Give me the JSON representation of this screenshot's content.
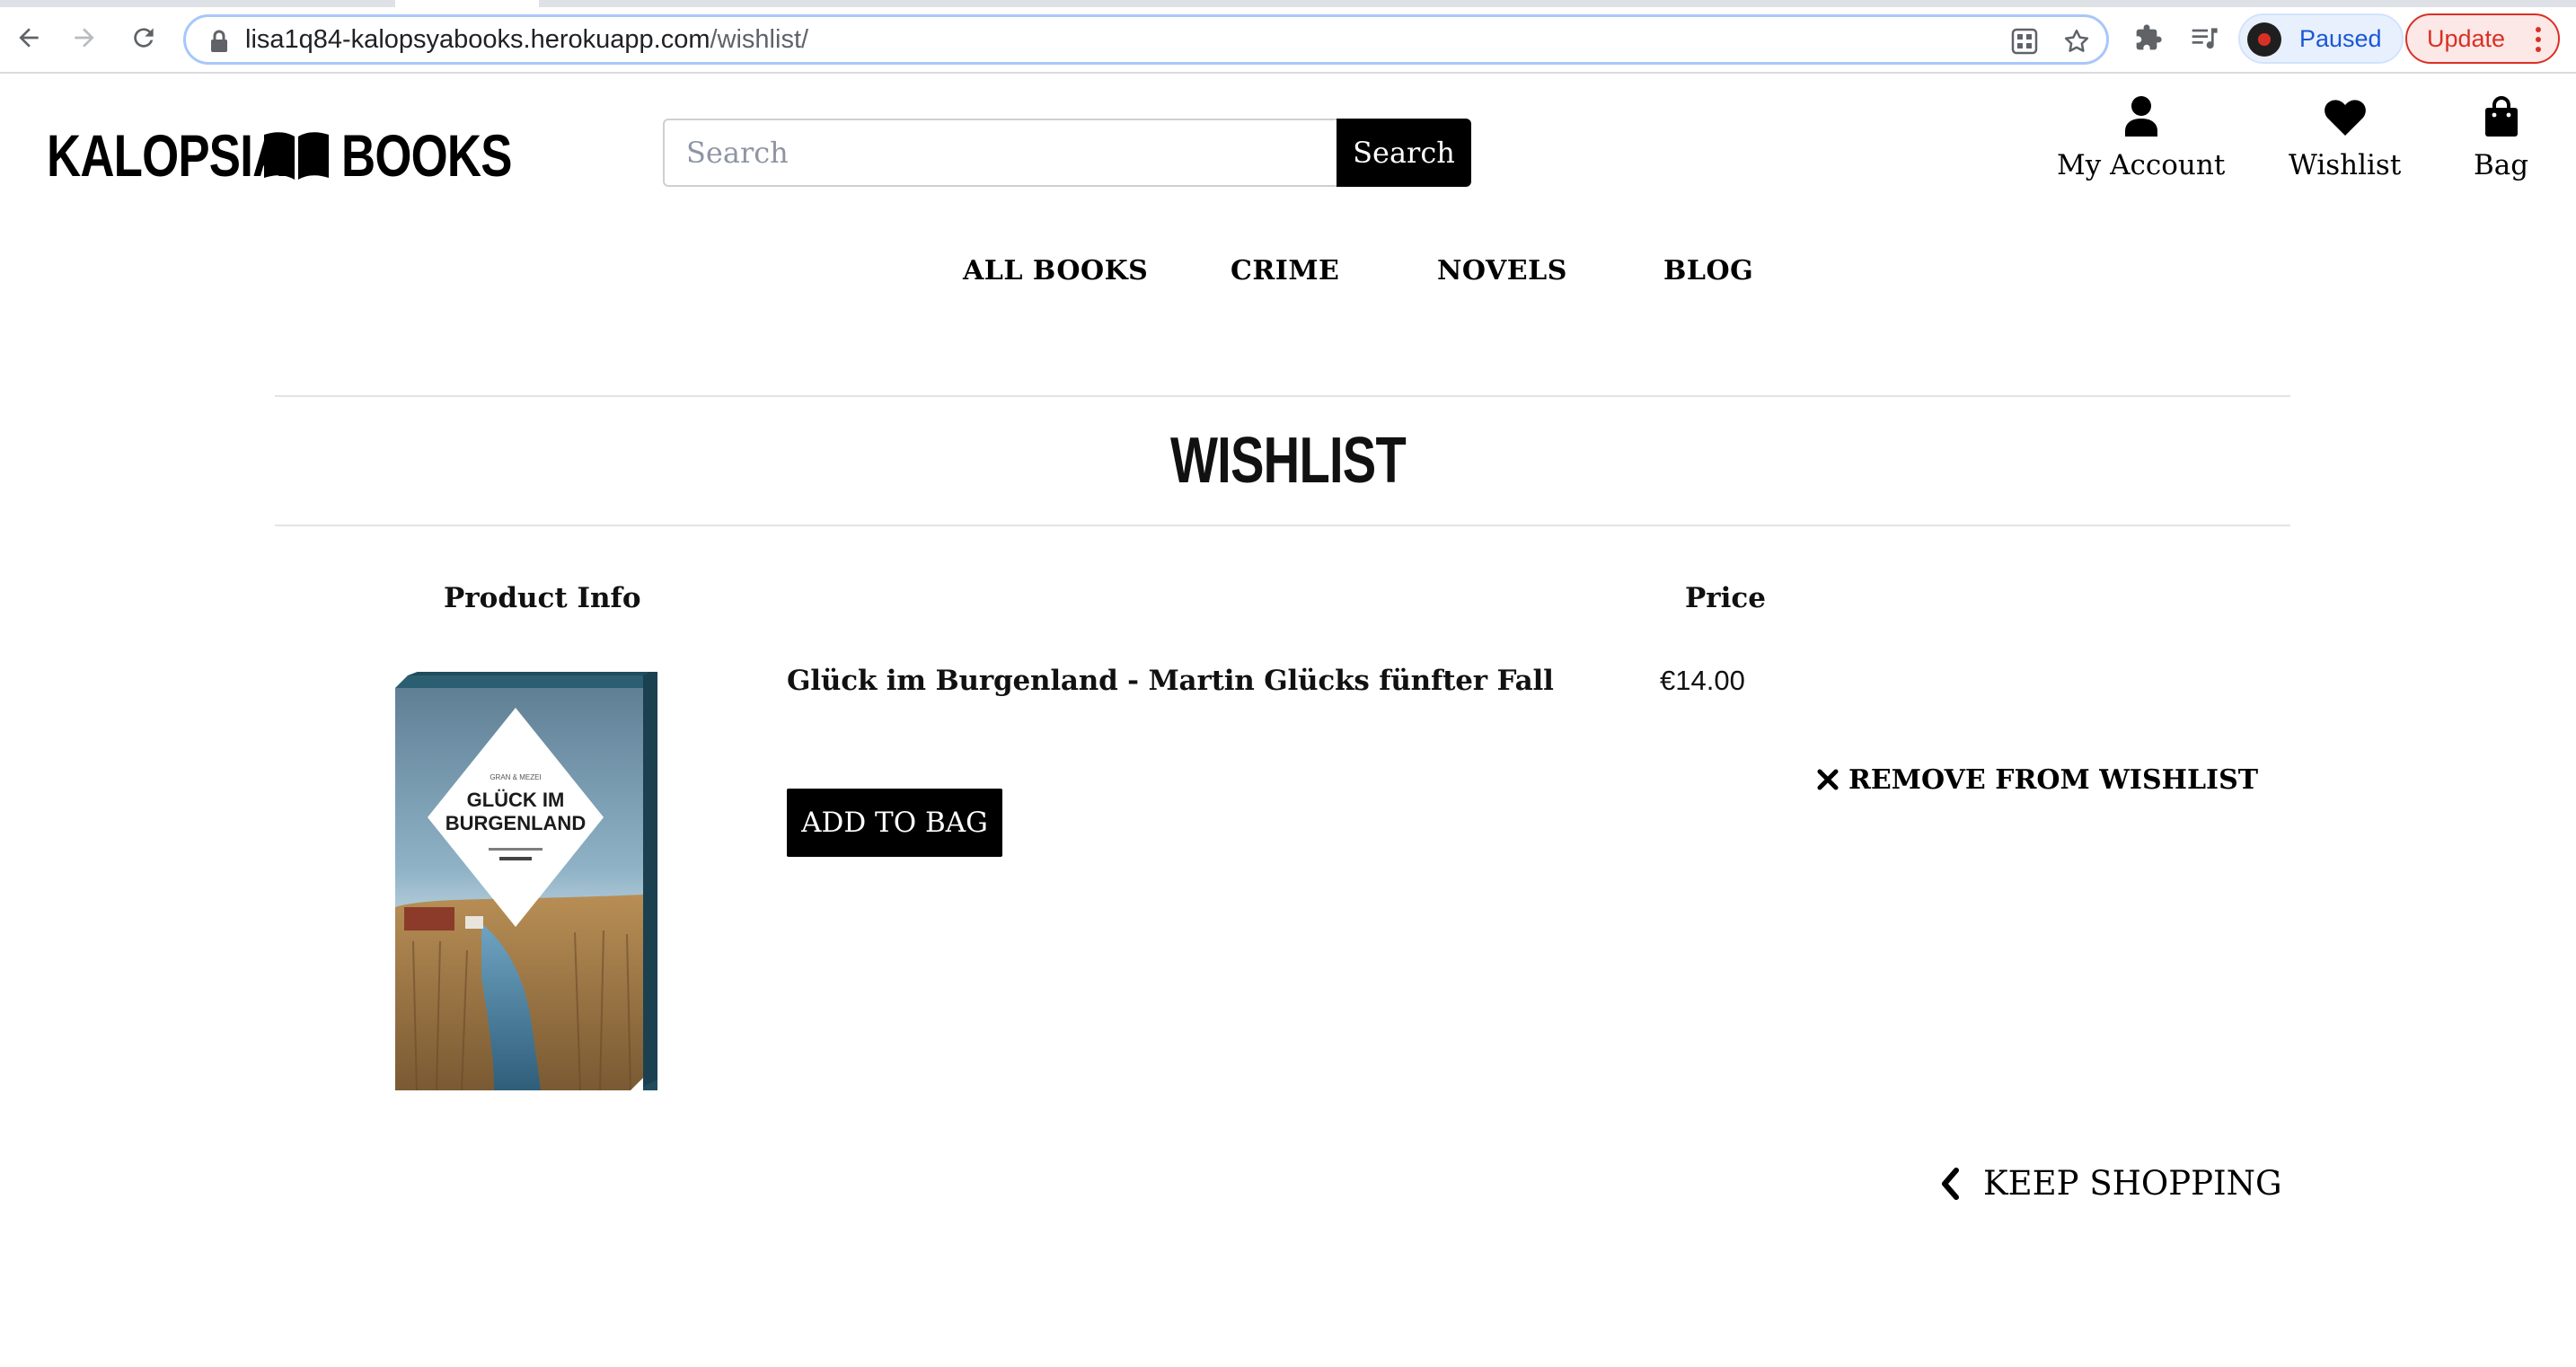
{
  "browser": {
    "url_host": "lisa1q84-kalopsyabooks.herokuapp.com",
    "url_path": "/wishlist/",
    "profile_status": "Paused",
    "update_label": "Update"
  },
  "site": {
    "logo_left": "KALOPSIA",
    "logo_right": "BOOKS",
    "search_placeholder": "Search",
    "search_button": "Search",
    "account_label": "My Account",
    "wishlist_label": "Wishlist",
    "bag_label": "Bag"
  },
  "nav": {
    "items": [
      "ALL BOOKS",
      "CRIME",
      "NOVELS",
      "BLOG"
    ]
  },
  "page": {
    "title": "WISHLIST",
    "col_product": "Product Info",
    "col_price": "Price"
  },
  "wishlist": {
    "items": [
      {
        "title": "Glück im Burgenland - Martin Glücks fünfter Fall",
        "price": "€14.00",
        "add_label": "ADD TO BAG",
        "remove_label": "REMOVE FROM WISHLIST",
        "cover_text_top": "GLÜCK IM",
        "cover_text_bottom": "BURGENLAND"
      }
    ]
  },
  "footer_actions": {
    "keep_shopping": "KEEP SHOPPING"
  }
}
